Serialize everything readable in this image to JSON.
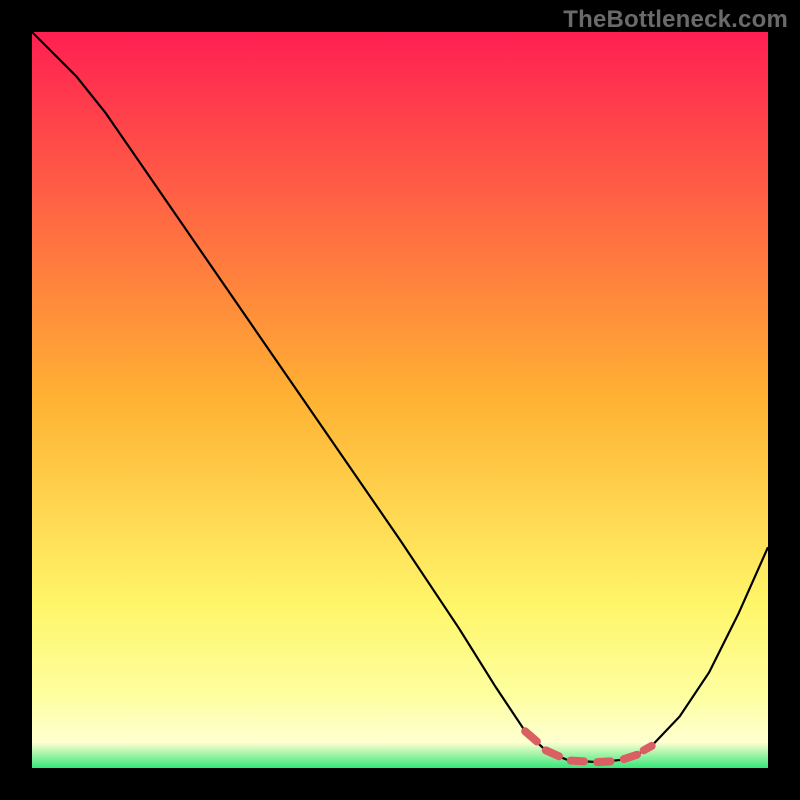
{
  "watermark": "TheBottleneck.com",
  "chart_data": {
    "type": "line",
    "title": "",
    "xlabel": "",
    "ylabel": "",
    "xlim": [
      0,
      100
    ],
    "ylim": [
      0,
      100
    ],
    "grid": false,
    "legend": false,
    "annotations": [],
    "background_gradient_stops": [
      {
        "offset": 0.0,
        "color": "#ff1f52"
      },
      {
        "offset": 0.5,
        "color": "#ffb233"
      },
      {
        "offset": 0.78,
        "color": "#fff66a"
      },
      {
        "offset": 0.9,
        "color": "#fdff9f"
      },
      {
        "offset": 0.965,
        "color": "#ffffd0"
      },
      {
        "offset": 1.0,
        "color": "#37e77a"
      }
    ],
    "series": [
      {
        "name": "curve",
        "color": "#000000",
        "points": [
          {
            "x": 0,
            "y": 100
          },
          {
            "x": 6,
            "y": 94
          },
          {
            "x": 10,
            "y": 89
          },
          {
            "x": 20,
            "y": 74.5
          },
          {
            "x": 30,
            "y": 60
          },
          {
            "x": 40,
            "y": 45.5
          },
          {
            "x": 50,
            "y": 31
          },
          {
            "x": 58,
            "y": 19
          },
          {
            "x": 63,
            "y": 11
          },
          {
            "x": 67,
            "y": 5
          },
          {
            "x": 70,
            "y": 2.2
          },
          {
            "x": 73,
            "y": 1.0
          },
          {
            "x": 77,
            "y": 0.8
          },
          {
            "x": 81,
            "y": 1.2
          },
          {
            "x": 84,
            "y": 2.8
          },
          {
            "x": 88,
            "y": 7
          },
          {
            "x": 92,
            "y": 13
          },
          {
            "x": 96,
            "y": 21
          },
          {
            "x": 100,
            "y": 30
          }
        ]
      },
      {
        "name": "highlight-dashes",
        "color": "#da5f63",
        "stroke_width": 8,
        "linecap": "round",
        "segments": [
          [
            {
              "x": 67.0,
              "y": 5.0
            },
            {
              "x": 68.6,
              "y": 3.6
            }
          ],
          [
            {
              "x": 69.8,
              "y": 2.4
            },
            {
              "x": 71.6,
              "y": 1.6
            }
          ],
          [
            {
              "x": 73.2,
              "y": 1.0
            },
            {
              "x": 75.0,
              "y": 0.9
            }
          ],
          [
            {
              "x": 76.8,
              "y": 0.8
            },
            {
              "x": 78.6,
              "y": 0.9
            }
          ],
          [
            {
              "x": 80.4,
              "y": 1.2
            },
            {
              "x": 82.2,
              "y": 1.8
            }
          ],
          [
            {
              "x": 83.1,
              "y": 2.4
            },
            {
              "x": 84.2,
              "y": 3.0
            }
          ]
        ]
      }
    ]
  }
}
